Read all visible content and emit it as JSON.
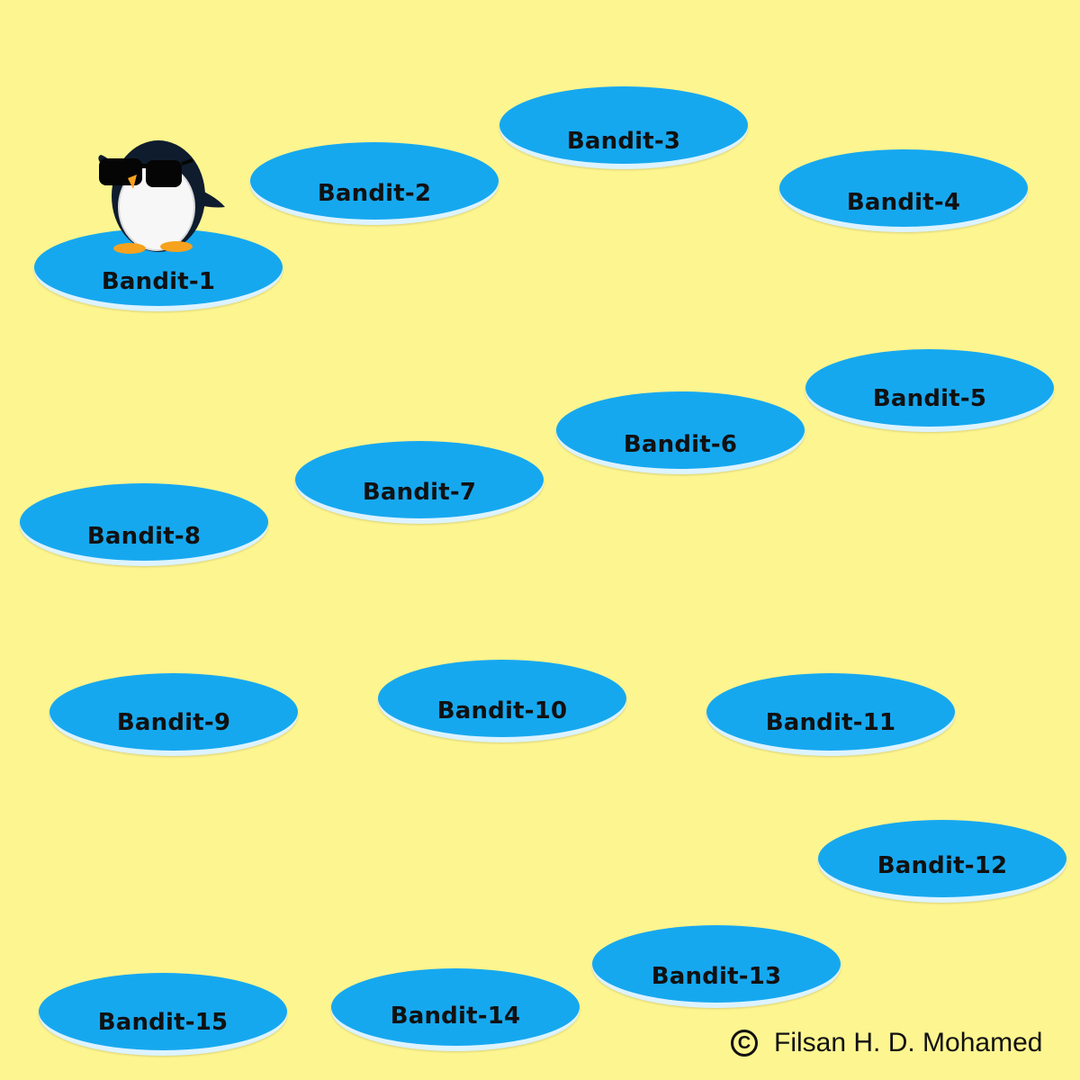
{
  "pads": [
    {
      "label": "Bandit-1"
    },
    {
      "label": "Bandit-2"
    },
    {
      "label": "Bandit-3"
    },
    {
      "label": "Bandit-4"
    },
    {
      "label": "Bandit-5"
    },
    {
      "label": "Bandit-6"
    },
    {
      "label": "Bandit-7"
    },
    {
      "label": "Bandit-8"
    },
    {
      "label": "Bandit-9"
    },
    {
      "label": "Bandit-10"
    },
    {
      "label": "Bandit-11"
    },
    {
      "label": "Bandit-12"
    },
    {
      "label": "Bandit-13"
    },
    {
      "label": "Bandit-14"
    },
    {
      "label": "Bandit-15"
    }
  ],
  "character": {
    "icon": "penguin-with-sunglasses-icon",
    "on_pad": "Bandit-1"
  },
  "credit": {
    "symbol": "C",
    "text": "Filsan H. D. Mohamed"
  },
  "colors": {
    "background": "#FDF58F",
    "pad": "#16A8EF",
    "pad_rim": "#DDF3FF",
    "text": "#111111"
  }
}
